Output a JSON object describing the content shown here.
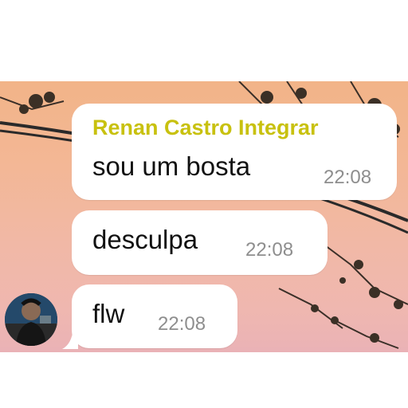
{
  "messages": [
    {
      "sender": "Renan Castro Integrar",
      "text": "sou um bosta",
      "time": "22:08"
    },
    {
      "text": "desculpa",
      "time": "22:08"
    },
    {
      "text": "flw",
      "time": "22:08"
    }
  ],
  "colors": {
    "sender_name": "#c8c10f",
    "bubble": "#ffffff",
    "timestamp": "#8e8e8e",
    "wallpaper_top": "#f2b488",
    "wallpaper_bottom": "#eab2b6"
  },
  "icons": [
    "avatar"
  ]
}
